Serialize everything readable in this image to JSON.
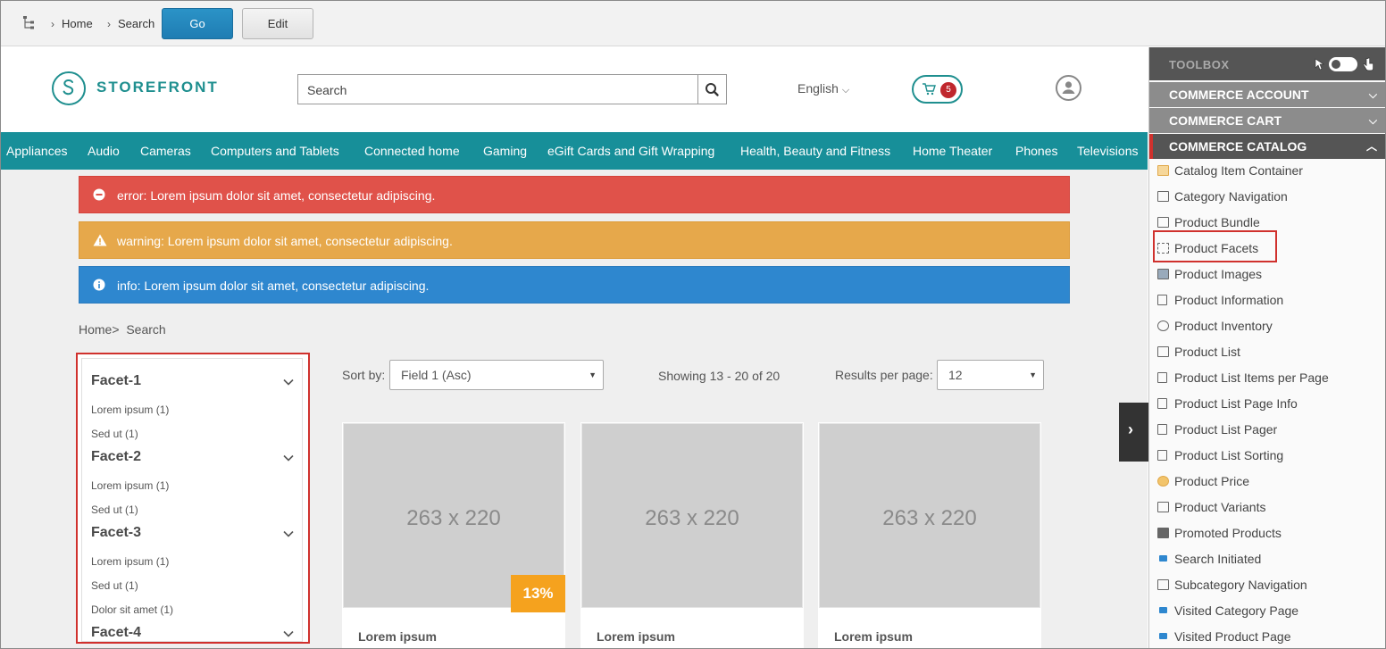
{
  "topbar": {
    "crumbs": [
      "Home",
      "Search"
    ],
    "go_label": "Go",
    "edit_label": "Edit"
  },
  "header": {
    "logo_text": "STOREFRONT",
    "search_placeholder": "Search",
    "language": "English",
    "cart_count": "5"
  },
  "nav": {
    "items": [
      "Appliances",
      "Audio",
      "Cameras",
      "Computers and Tablets",
      "Connected home",
      "Gaming",
      "eGift Cards and Gift Wrapping",
      "Health, Beauty and Fitness",
      "Home Theater",
      "Phones",
      "Televisions"
    ]
  },
  "alerts": {
    "error": "error: Lorem ipsum dolor sit amet, consectetur adipiscing.",
    "warning": "warning: Lorem ipsum dolor sit amet, consectetur adipiscing.",
    "info": "info: Lorem ipsum dolor sit amet, consectetur adipiscing."
  },
  "breadcrumb": {
    "home": "Home",
    "current": "Search"
  },
  "facets": [
    {
      "title": "Facet-1",
      "options": [
        "Lorem ipsum (1)",
        "Sed ut (1)"
      ]
    },
    {
      "title": "Facet-2",
      "options": [
        "Lorem ipsum (1)",
        "Sed ut (1)"
      ]
    },
    {
      "title": "Facet-3",
      "options": [
        "Lorem ipsum (1)",
        "Sed ut (1)",
        "Dolor sit amet (1)"
      ]
    },
    {
      "title": "Facet-4",
      "options": []
    }
  ],
  "listing": {
    "sort_label": "Sort by:",
    "sort_value": "Field 1 (Asc)",
    "showing": "Showing 13 - 20 of 20",
    "rpp_label": "Results per page:",
    "rpp_value": "12"
  },
  "products": [
    {
      "image_label": "263 x 220",
      "name": "Lorem ipsum",
      "discount": "13%"
    },
    {
      "image_label": "263 x 220",
      "name": "Lorem ipsum",
      "discount": ""
    },
    {
      "image_label": "263 x 220",
      "name": "Lorem ipsum",
      "discount": ""
    }
  ],
  "toolbox": {
    "title": "TOOLBOX",
    "sections": [
      "COMMERCE ACCOUNT",
      "COMMERCE CART",
      "COMMERCE CATALOG"
    ],
    "items": [
      "Catalog Item Container",
      "Category Navigation",
      "Product Bundle",
      "Product Facets",
      "Product Images",
      "Product Information",
      "Product Inventory",
      "Product List",
      "Product List Items per Page",
      "Product List Page Info",
      "Product List Pager",
      "Product List Sorting",
      "Product Price",
      "Product Variants",
      "Promoted Products",
      "Search Initiated",
      "Subcategory Navigation",
      "Visited Category Page",
      "Visited Product Page"
    ],
    "highlighted_item": "Product Facets"
  },
  "colors": {
    "accent_teal": "#178f99",
    "error_red": "#e0524a",
    "warning_orange": "#e6a84b",
    "info_blue": "#2e87cf",
    "highlight_red": "#d0312d",
    "discount_orange": "#f5a21e"
  }
}
